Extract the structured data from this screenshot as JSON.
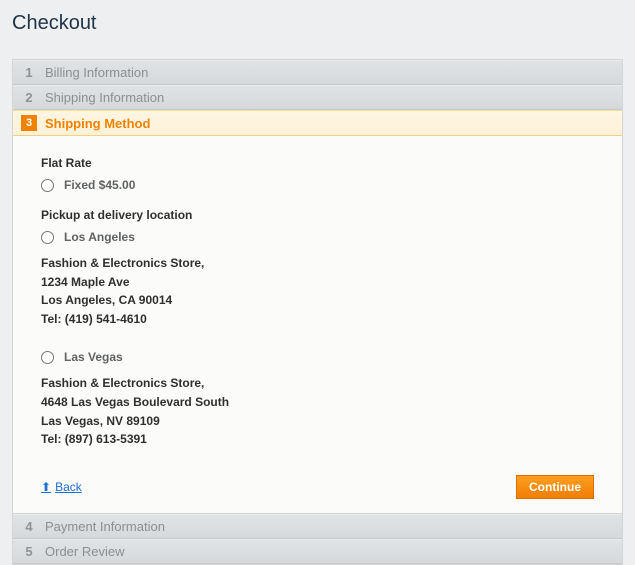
{
  "page_title": "Checkout",
  "steps": {
    "billing": {
      "num": "1",
      "title": "Billing Information"
    },
    "shipping": {
      "num": "2",
      "title": "Shipping Information"
    },
    "method": {
      "num": "3",
      "title": "Shipping Method"
    },
    "payment": {
      "num": "4",
      "title": "Payment Information"
    },
    "review": {
      "num": "5",
      "title": "Order Review"
    }
  },
  "shipping_method": {
    "flat_rate_heading": "Flat Rate",
    "flat_rate_option": "Fixed $45.00",
    "pickup_heading": "Pickup at delivery location",
    "locations": [
      {
        "name": "Los Angeles",
        "line1": "Fashion & Electronics Store,",
        "line2": "1234 Maple Ave",
        "line3": "Los Angeles, CA 90014",
        "line4": "Tel: (419) 541-4610"
      },
      {
        "name": "Las Vegas",
        "line1": "Fashion & Electronics Store,",
        "line2": "4648 Las Vegas Boulevard South",
        "line3": "Las Vegas, NV 89109",
        "line4": "Tel: (897) 613-5391"
      }
    ]
  },
  "actions": {
    "back": "Back",
    "continue": "Continue"
  }
}
